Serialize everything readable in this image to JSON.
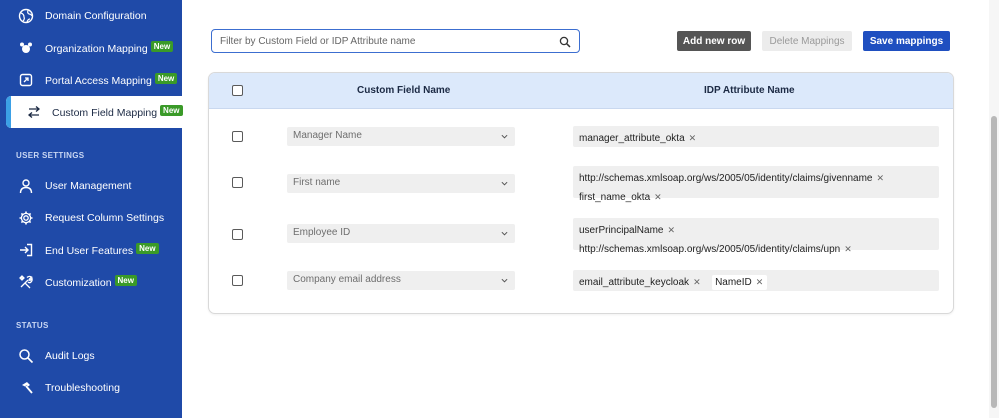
{
  "sidebar": {
    "items": [
      {
        "label": "Domain Configuration",
        "icon": "globe-icon"
      },
      {
        "label": "Organization Mapping",
        "icon": "organization-icon",
        "badge": "New"
      },
      {
        "label": "Portal Access Mapping",
        "icon": "portal-icon",
        "badge": "New"
      },
      {
        "label": "Custom Field Mapping",
        "icon": "swap-arrows-icon",
        "badge": "New"
      }
    ],
    "user_settings_title": "USER SETTINGS",
    "user_settings": [
      {
        "label": "User Management",
        "icon": "user-icon"
      },
      {
        "label": "Request Column Settings",
        "icon": "gear-icon"
      },
      {
        "label": "End User Features",
        "icon": "login-icon",
        "badge": "New"
      },
      {
        "label": "Customization",
        "icon": "tools-icon",
        "badge": "New"
      }
    ],
    "status_title": "STATUS",
    "status": [
      {
        "label": "Audit Logs",
        "icon": "search-icon"
      },
      {
        "label": "Troubleshooting",
        "icon": "hammer-icon"
      }
    ]
  },
  "toolbar": {
    "search_placeholder": "Filter by Custom Field or IDP Attribute name",
    "add_label": "Add new row",
    "delete_label": "Delete Mappings",
    "save_label": "Save mappings"
  },
  "table": {
    "headers": {
      "custom_field": "Custom Field Name",
      "idp_attribute": "IDP Attribute Name"
    },
    "rows": [
      {
        "custom_field": "Manager Name",
        "attributes": [
          "manager_attribute_okta"
        ]
      },
      {
        "custom_field": "First name",
        "attributes": [
          "http://schemas.xmlsoap.org/ws/2005/05/identity/claims/givenname",
          "first_name_okta"
        ]
      },
      {
        "custom_field": "Employee ID",
        "attributes": [
          "userPrincipalName",
          "http://schemas.xmlsoap.org/ws/2005/05/identity/claims/upn"
        ]
      },
      {
        "custom_field": "Company email address",
        "attributes": [
          "email_attribute_keycloak",
          "NameID"
        ]
      }
    ]
  },
  "colors": {
    "sidebar": "#1f4aa8",
    "accent": "#1f4fc0",
    "badge": "#3a9a28",
    "header": "#dce9fb"
  }
}
